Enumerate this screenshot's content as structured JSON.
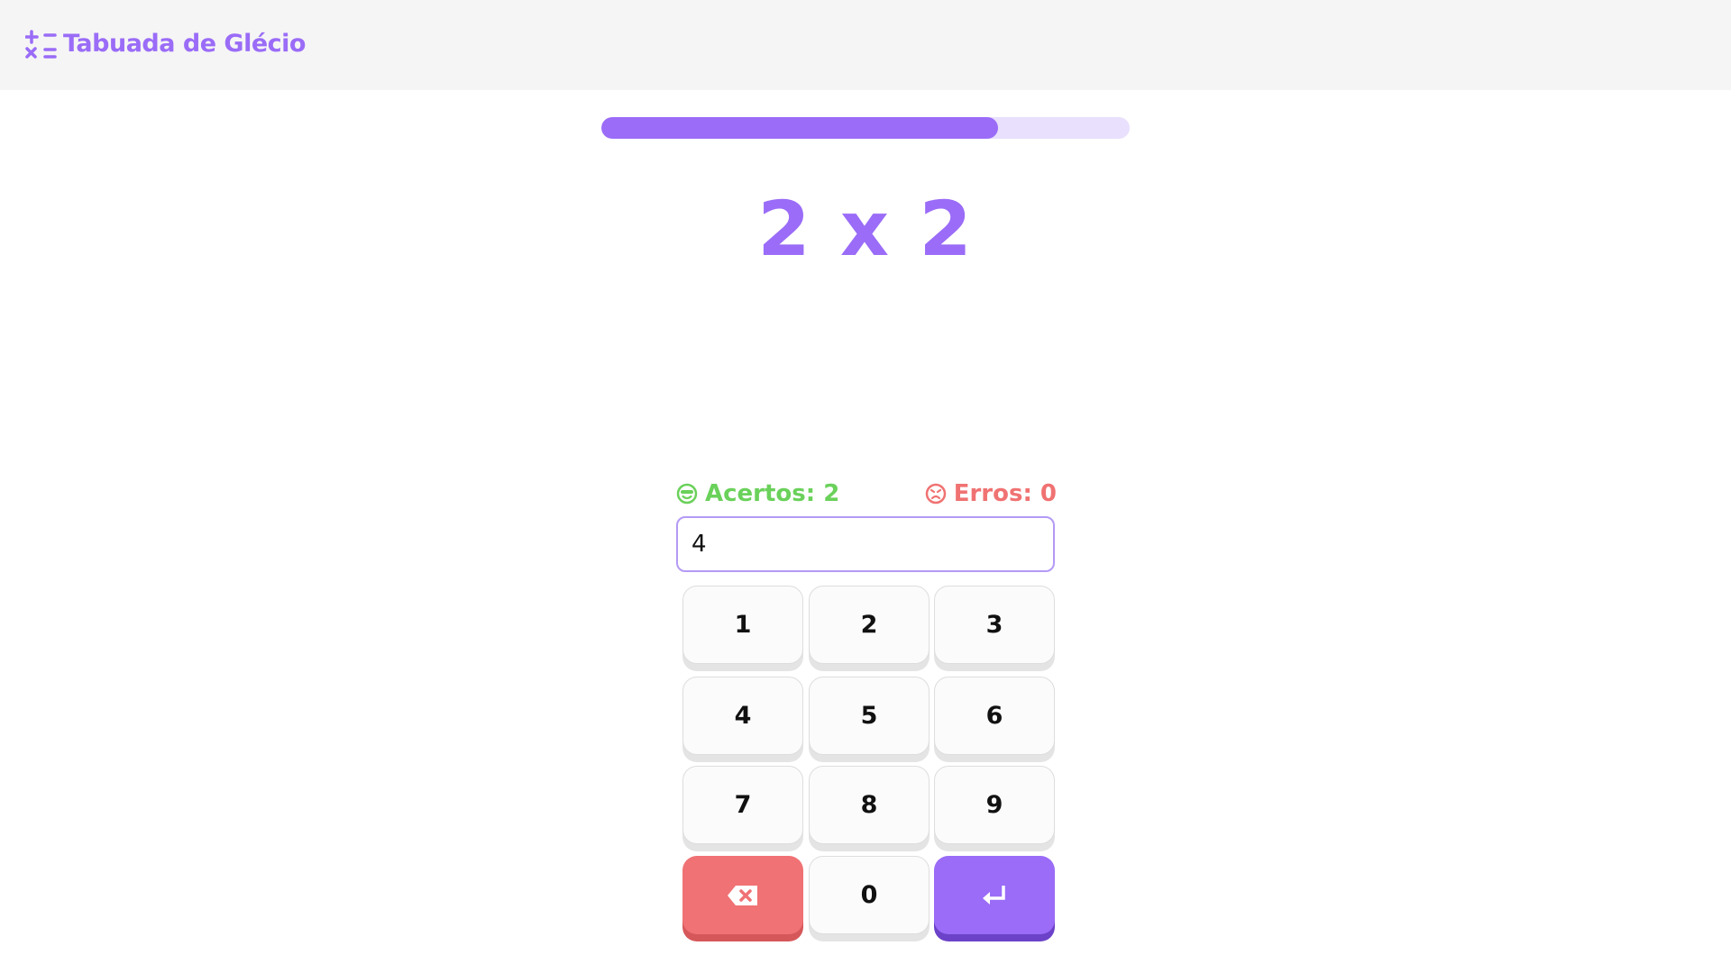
{
  "header": {
    "title": "Tabuada de Glécio",
    "logo_icon": "calculator-symbols-icon"
  },
  "progress": {
    "percent": 75
  },
  "question": {
    "text": "2 x 2"
  },
  "stats": {
    "correct_label": "Acertos: 2",
    "errors_label": "Erros: 0"
  },
  "answer": {
    "value": "4"
  },
  "keypad": {
    "keys": [
      "1",
      "2",
      "3",
      "4",
      "5",
      "6",
      "7",
      "8",
      "9"
    ],
    "zero": "0",
    "delete_icon": "backspace-icon",
    "enter_icon": "enter-icon"
  },
  "colors": {
    "accent": "#9a6cf7",
    "correct": "#6ad15a",
    "error": "#f07272"
  }
}
